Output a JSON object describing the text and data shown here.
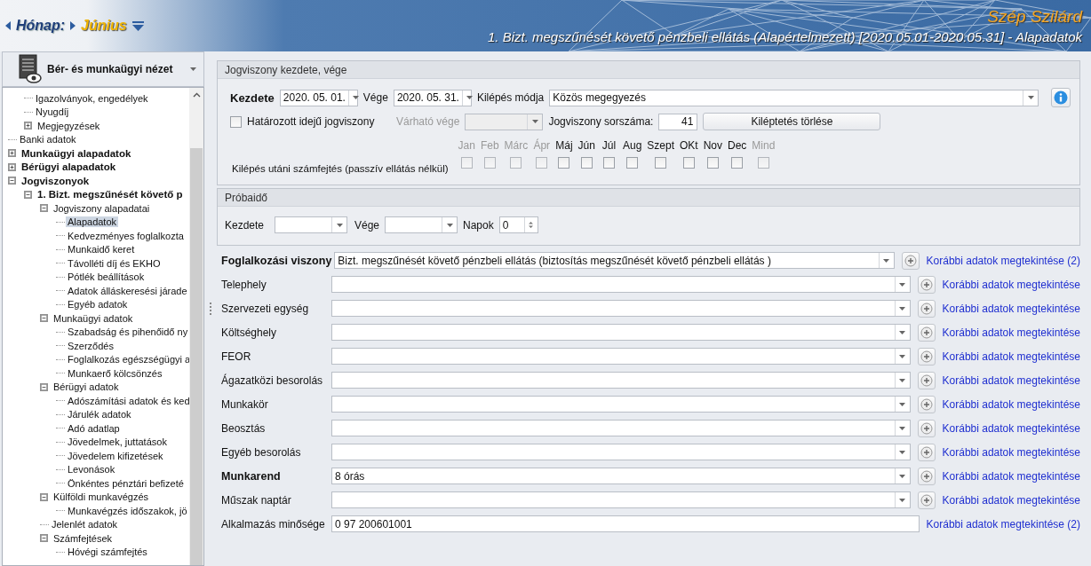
{
  "header": {
    "nav_label": "Hónap:",
    "month": "Június",
    "user": "Szép Szilárd",
    "title": "1. Bizt. megszűnését követő pénzbeli ellátás (Alapértelmezett) [2020.05.01-2020.05.31] - Alapadatok"
  },
  "sidebar": {
    "view": "Bér- és munkaügyi nézet",
    "tree_continued": [
      {
        "label": "Igazolványok, engedélyek",
        "bold": false,
        "selected": false
      },
      {
        "label": "Nyugdíj",
        "bold": false,
        "selected": false
      },
      {
        "label": "Megjegyzések",
        "bold": false,
        "selected": false,
        "expanded": false
      }
    ],
    "tree": [
      {
        "label": "Banki adatok",
        "bold": false,
        "selected": false
      },
      {
        "label": "Munkaügyi alapadatok",
        "bold": true,
        "selected": false,
        "expanded": false
      },
      {
        "label": "Bérügyi alapadatok",
        "bold": true,
        "selected": false,
        "expanded": false
      },
      {
        "label": "Jogviszonyok",
        "bold": true,
        "selected": false,
        "expanded": true,
        "children": [
          {
            "label": "1. Bizt. megszűnését követő p",
            "bold": true,
            "selected": false,
            "expanded": true,
            "children": [
              {
                "label": "Jogviszony alapadatai",
                "bold": false,
                "selected": false,
                "expanded": true,
                "children": [
                  {
                    "label": "Alapadatok",
                    "bold": false,
                    "selected": true
                  },
                  {
                    "label": "Kedvezményes foglalkozta",
                    "bold": false,
                    "selected": false
                  },
                  {
                    "label": "Munkaidő keret",
                    "bold": false,
                    "selected": false
                  },
                  {
                    "label": "Távolléti díj és EKHO",
                    "bold": false,
                    "selected": false
                  },
                  {
                    "label": "Pótlék beállítások",
                    "bold": false,
                    "selected": false
                  },
                  {
                    "label": "Adatok álláskeresési járade",
                    "bold": false,
                    "selected": false
                  },
                  {
                    "label": "Egyéb adatok",
                    "bold": false,
                    "selected": false
                  }
                ]
              },
              {
                "label": "Munkaügyi adatok",
                "bold": false,
                "selected": false,
                "expanded": true,
                "children": [
                  {
                    "label": "Szabadság és pihenőidő ny",
                    "bold": false,
                    "selected": false
                  },
                  {
                    "label": "Szerződés",
                    "bold": false,
                    "selected": false
                  },
                  {
                    "label": "Foglalkozás egészségügyi a",
                    "bold": false,
                    "selected": false
                  },
                  {
                    "label": "Munkaerő kölcsönzés",
                    "bold": false,
                    "selected": false
                  }
                ]
              },
              {
                "label": "Bérügyi adatok",
                "bold": false,
                "selected": false,
                "expanded": true,
                "children": [
                  {
                    "label": "Adószámítási adatok és ked",
                    "bold": false,
                    "selected": false
                  },
                  {
                    "label": "Járulék adatok",
                    "bold": false,
                    "selected": false
                  },
                  {
                    "label": "Adó adatlap",
                    "bold": false,
                    "selected": false
                  },
                  {
                    "label": "Jövedelmek, juttatások",
                    "bold": false,
                    "selected": false
                  },
                  {
                    "label": "Jövedelem kifizetések",
                    "bold": false,
                    "selected": false
                  },
                  {
                    "label": "Levonások",
                    "bold": false,
                    "selected": false
                  },
                  {
                    "label": "Önkéntes pénztári befizeté",
                    "bold": false,
                    "selected": false
                  }
                ]
              },
              {
                "label": "Külföldi munkavégzés",
                "bold": false,
                "selected": false,
                "expanded": true,
                "children": [
                  {
                    "label": "Munkavégzés időszakok, jö",
                    "bold": false,
                    "selected": false
                  }
                ]
              },
              {
                "label": "Jelenlét adatok",
                "bold": false,
                "selected": false
              },
              {
                "label": "Számfejtések",
                "bold": false,
                "selected": false,
                "expanded": true,
                "children": [
                  {
                    "label": "Hóvégi számfejtés",
                    "bold": false,
                    "selected": false
                  }
                ]
              }
            ]
          }
        ]
      }
    ]
  },
  "employment_period": {
    "title": "Jogviszony kezdete, vége",
    "start_label": "Kezdete",
    "start": "2020. 05. 01.",
    "end_label": "Vége",
    "end": "2020. 05. 31.",
    "exit_mode_label": "Kilépés módja",
    "exit_mode": "Közös megegyezés",
    "fixed_term": {
      "label": "Határozott idejű jogviszony",
      "checked": false
    },
    "expected_end": {
      "label": "Várható vége",
      "disabled": true
    },
    "serial_label": "Jogviszony sorszáma:",
    "serial": "41",
    "clear_button": "Kiléptetés törlése",
    "post_exit_label": "Kilépés utáni számfejtés (passzív ellátás nélkül)",
    "months": [
      {
        "label": "Jan",
        "disabled": true,
        "checked": false
      },
      {
        "label": "Feb",
        "disabled": true,
        "checked": false
      },
      {
        "label": "Márc",
        "disabled": true,
        "checked": false
      },
      {
        "label": "Ápr",
        "disabled": true,
        "checked": false
      },
      {
        "label": "Máj",
        "disabled": false,
        "checked": false
      },
      {
        "label": "Jún",
        "disabled": false,
        "checked": false
      },
      {
        "label": "Júl",
        "disabled": false,
        "checked": false
      },
      {
        "label": "Aug",
        "disabled": false,
        "checked": false
      },
      {
        "label": "Szept",
        "disabled": false,
        "checked": false
      },
      {
        "label": "OKt",
        "disabled": false,
        "checked": false
      },
      {
        "label": "Nov",
        "disabled": false,
        "checked": false
      },
      {
        "label": "Dec",
        "disabled": false,
        "checked": false
      },
      {
        "label": "Mind",
        "disabled": true,
        "checked": false
      }
    ]
  },
  "probation": {
    "title": "Próbaidő",
    "start_label": "Kezdete",
    "end_label": "Vége",
    "days_label": "Napok",
    "days": "0"
  },
  "fields": [
    {
      "label": "Foglalkozási viszony",
      "bold": true,
      "kind": "combo",
      "value": "Bizt. megszűnését követő pénzbeli ellátás (biztosítás megszűnését követő pénzbeli ellátás )",
      "add_button": true,
      "link": "Korábbi adatok megtekintése (2)"
    },
    {
      "label": "Telephely",
      "bold": false,
      "kind": "combo",
      "add_button": true,
      "link": "Korábbi adatok megtekintése"
    },
    {
      "label": "Szervezeti egység",
      "bold": false,
      "kind": "combo",
      "add_button": true,
      "link": "Korábbi adatok megtekintése"
    },
    {
      "label": "Költséghely",
      "bold": false,
      "kind": "combo",
      "add_button": true,
      "link": "Korábbi adatok megtekintése"
    },
    {
      "label": "FEOR",
      "bold": false,
      "kind": "combo",
      "add_button": true,
      "link": "Korábbi adatok megtekintése"
    },
    {
      "label": "Ágazatközi besorolás",
      "bold": false,
      "kind": "combo",
      "add_button": true,
      "link": "Korábbi adatok megtekintése"
    },
    {
      "label": "Munkakör",
      "bold": false,
      "kind": "combo",
      "add_button": true,
      "link": "Korábbi adatok megtekintése"
    },
    {
      "label": "Beosztás",
      "bold": false,
      "kind": "combo",
      "add_button": true,
      "link": "Korábbi adatok megtekintése"
    },
    {
      "label": "Egyéb besorolás",
      "bold": false,
      "kind": "combo",
      "add_button": true,
      "link": "Korábbi adatok megtekintése"
    },
    {
      "label": "Munkarend",
      "bold": true,
      "kind": "combo",
      "value": "8 órás",
      "add_button": true,
      "link": "Korábbi adatok megtekintése"
    },
    {
      "label": "Műszak naptár",
      "bold": false,
      "kind": "combo",
      "add_button": true,
      "link": "Korábbi adatok megtekintése"
    },
    {
      "label": "Alkalmazás minősége",
      "bold": false,
      "kind": "text",
      "value": "0 97 200601001",
      "add_button": false,
      "link": "Korábbi adatok megtekintése (2)"
    }
  ]
}
